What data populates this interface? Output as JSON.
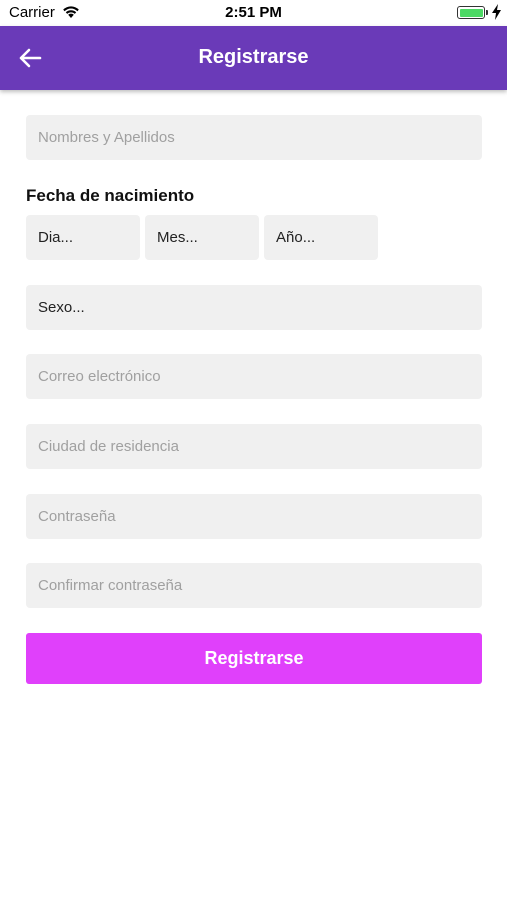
{
  "status_bar": {
    "carrier": "Carrier",
    "time": "2:51 PM",
    "battery_level": 1.0,
    "battery_color": "#4cd964"
  },
  "nav": {
    "back_icon": "arrow-left-icon",
    "title": "Registrarse",
    "color": "#6a3ab8"
  },
  "form": {
    "name_placeholder": "Nombres y Apellidos",
    "birth_label": "Fecha de nacimiento",
    "day": "Dia...",
    "month": "Mes...",
    "year": "Año...",
    "sex": "Sexo...",
    "email_placeholder": "Correo electrónico",
    "city_placeholder": "Ciudad de residencia",
    "password_placeholder": "Contraseña",
    "confirm_password_placeholder": "Confirmar contraseña",
    "submit_label": "Registrarse",
    "submit_color": "#e040fb"
  }
}
